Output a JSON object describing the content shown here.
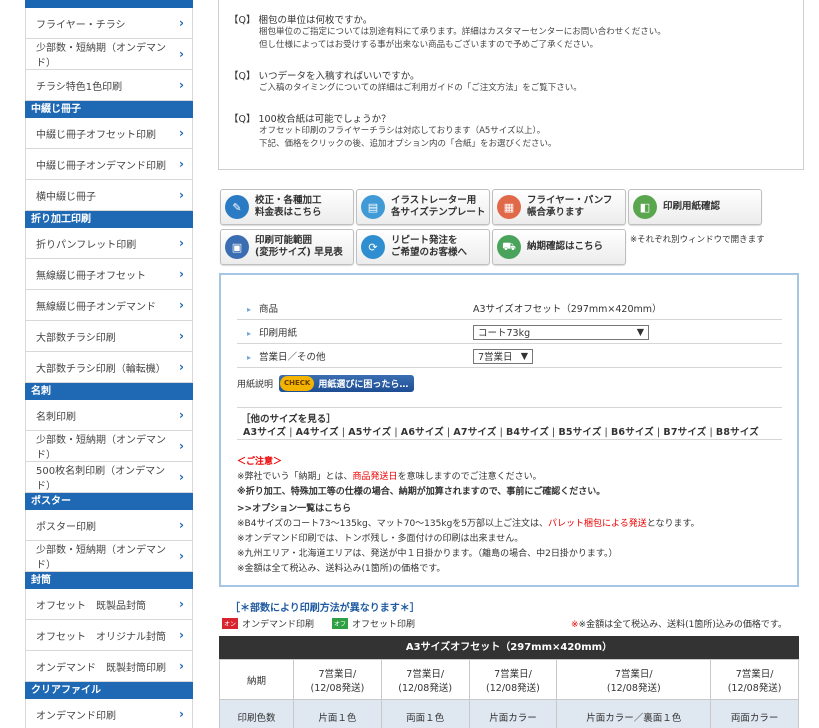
{
  "sidebar": {
    "groups": [
      {
        "heading": "",
        "items": [
          "フライヤー・チラシ",
          "少部数・短納期（オンデマンド）",
          "チラシ特色1色印刷"
        ]
      },
      {
        "heading": "中綴じ冊子",
        "items": [
          "中綴じ冊子オフセット印刷",
          "中綴じ冊子オンデマンド印刷",
          "横中綴じ冊子"
        ]
      },
      {
        "heading": "折り加工印刷",
        "items": [
          "折りパンフレット印刷",
          "無線綴じ冊子オフセット",
          "無線綴じ冊子オンデマンド",
          "大部数チラシ印刷",
          "大部数チラシ印刷（輪転機）"
        ]
      },
      {
        "heading": "名刺",
        "items": [
          "名刺印刷",
          "少部数・短納期（オンデマンド）",
          "500枚名刺印刷（オンデマンド）"
        ]
      },
      {
        "heading": "ポスター",
        "items": [
          "ポスター印刷",
          "少部数・短納期（オンデマンド）"
        ]
      },
      {
        "heading": "封筒",
        "items": [
          "オフセット　既製品封筒",
          "オフセット　オリジナル封筒",
          "オンデマンド　既製封筒印刷"
        ]
      },
      {
        "heading": "クリアファイル",
        "items": [
          "オンデマンド印刷"
        ]
      }
    ]
  },
  "faq": [
    {
      "q": "【Q】 梱包の単位は何枚ですか。",
      "a": [
        "梱包単位のご指定については別途有料にて承ります。詳細はカスタマーセンターにお問い合わせください。",
        "但し仕様によってはお受けする事が出来ない商品もございますので予めご了承ください。"
      ]
    },
    {
      "q": "【Q】 いつデータを入稿すればいいですか。",
      "a": [
        "ご入稿のタイミングについての詳細はご利用ガイドの「ご注文方法」をご覧下さい。"
      ]
    },
    {
      "q": "【Q】 100枚合紙は可能でしょうか？",
      "a": [
        "オフセット印刷のフライヤーチラシは対応しております（A5サイズ以上）。",
        "下記、価格をクリックの後、追加オプション内の「合紙」をお選びください。"
      ]
    }
  ],
  "buttons": [
    {
      "label": "校正・各種加工\n料金表はこちら",
      "icon": "pencil-icon",
      "color": "#2a7bc4"
    },
    {
      "label": "イラストレーター用\n各サイズテンプレート",
      "icon": "document-icon",
      "color": "#3f9ad6"
    },
    {
      "label": "フライヤー・パンフ\n帳合承ります",
      "icon": "flyer-icon",
      "color": "#e0694a"
    },
    {
      "label": "印刷用紙確認",
      "icon": "paper-icon",
      "color": "#5aa64f"
    },
    {
      "label": "印刷可能範囲\n(変形サイズ) 早見表",
      "icon": "monitor-icon",
      "color": "#3a6db1"
    },
    {
      "label": "リピート発注を\nご希望のお客様へ",
      "icon": "repeat-icon",
      "color": "#2f8ed0"
    },
    {
      "label": "納期確認はこちら",
      "icon": "truck-icon",
      "color": "#4aa35a"
    }
  ],
  "buttons_note": "※それぞれ別ウィンドウで開きます",
  "config": {
    "product_label": "商品",
    "product_value": "A3サイズオフセット（297mm×420mm）",
    "paper_label": "印刷用紙",
    "paper_value": "コート73kg",
    "day_label": "営業日／その他",
    "day_value": "7営業日",
    "paper_desc_label": "用紙説明",
    "check_tag": "CHECK",
    "check_label": "用紙選びに困ったら…",
    "sizes_title": "［他のサイズを見る］",
    "sizes": [
      "A3サイズ",
      "A4サイズ",
      "A5サイズ",
      "A6サイズ",
      "A7サイズ",
      "B4サイズ",
      "B5サイズ",
      "B6サイズ",
      "B7サイズ",
      "B8サイズ"
    ]
  },
  "caution": {
    "title": "＜ご注意＞",
    "line1_pre": "※弊社でいう「納期」とは、",
    "line1_red": "商品発送日",
    "line1_post": "を意味しますのでご注意ください。",
    "line2": "※折り加工、特殊加工等の仕様の場合、納期が加算されますので、事前にご確認ください。",
    "options_title": ">>オプション一覧はこちら",
    "line3_pre": "※B4サイズのコート73～135kg、マット70～135kgを5万部以上ご注文は、",
    "line3_red": "パレット梱包による発送",
    "line3_post": "となります。",
    "line4": "※オンデマンド印刷では、トンボ残し・多面付けの印刷は出来ません。",
    "line5": "※九州エリア・北海道エリアは、発送が中１日掛かります。（離島の場合、中2日掛かります。）",
    "line6": "※金額は全て税込み、送料込み(1箇所)の価格です。"
  },
  "pricing": {
    "heading": "［＊部数により印刷方法が異なります＊］",
    "legend_on": "オンデマンド印刷",
    "legend_on_tag": "オン",
    "legend_off": "オフセット印刷",
    "legend_off_tag": "オフ",
    "tax_note": "※金額は全て税込み、送料(1箇所)込みの価格です。",
    "table_title": "A3サイズオフセット（297mm×420mm）",
    "delivery_label": "納期",
    "delivery": [
      "7営業日/\n(12/08発送)",
      "7営業日/\n(12/08発送)",
      "7営業日/\n(12/08発送)",
      "7営業日/\n(12/08発送)",
      "7営業日/\n(12/08発送)"
    ],
    "colors_label": "印刷色数",
    "colors": [
      "片面１色",
      "両面１色",
      "片面カラー",
      "片面カラー／裏面１色",
      "両面カラー"
    ]
  }
}
